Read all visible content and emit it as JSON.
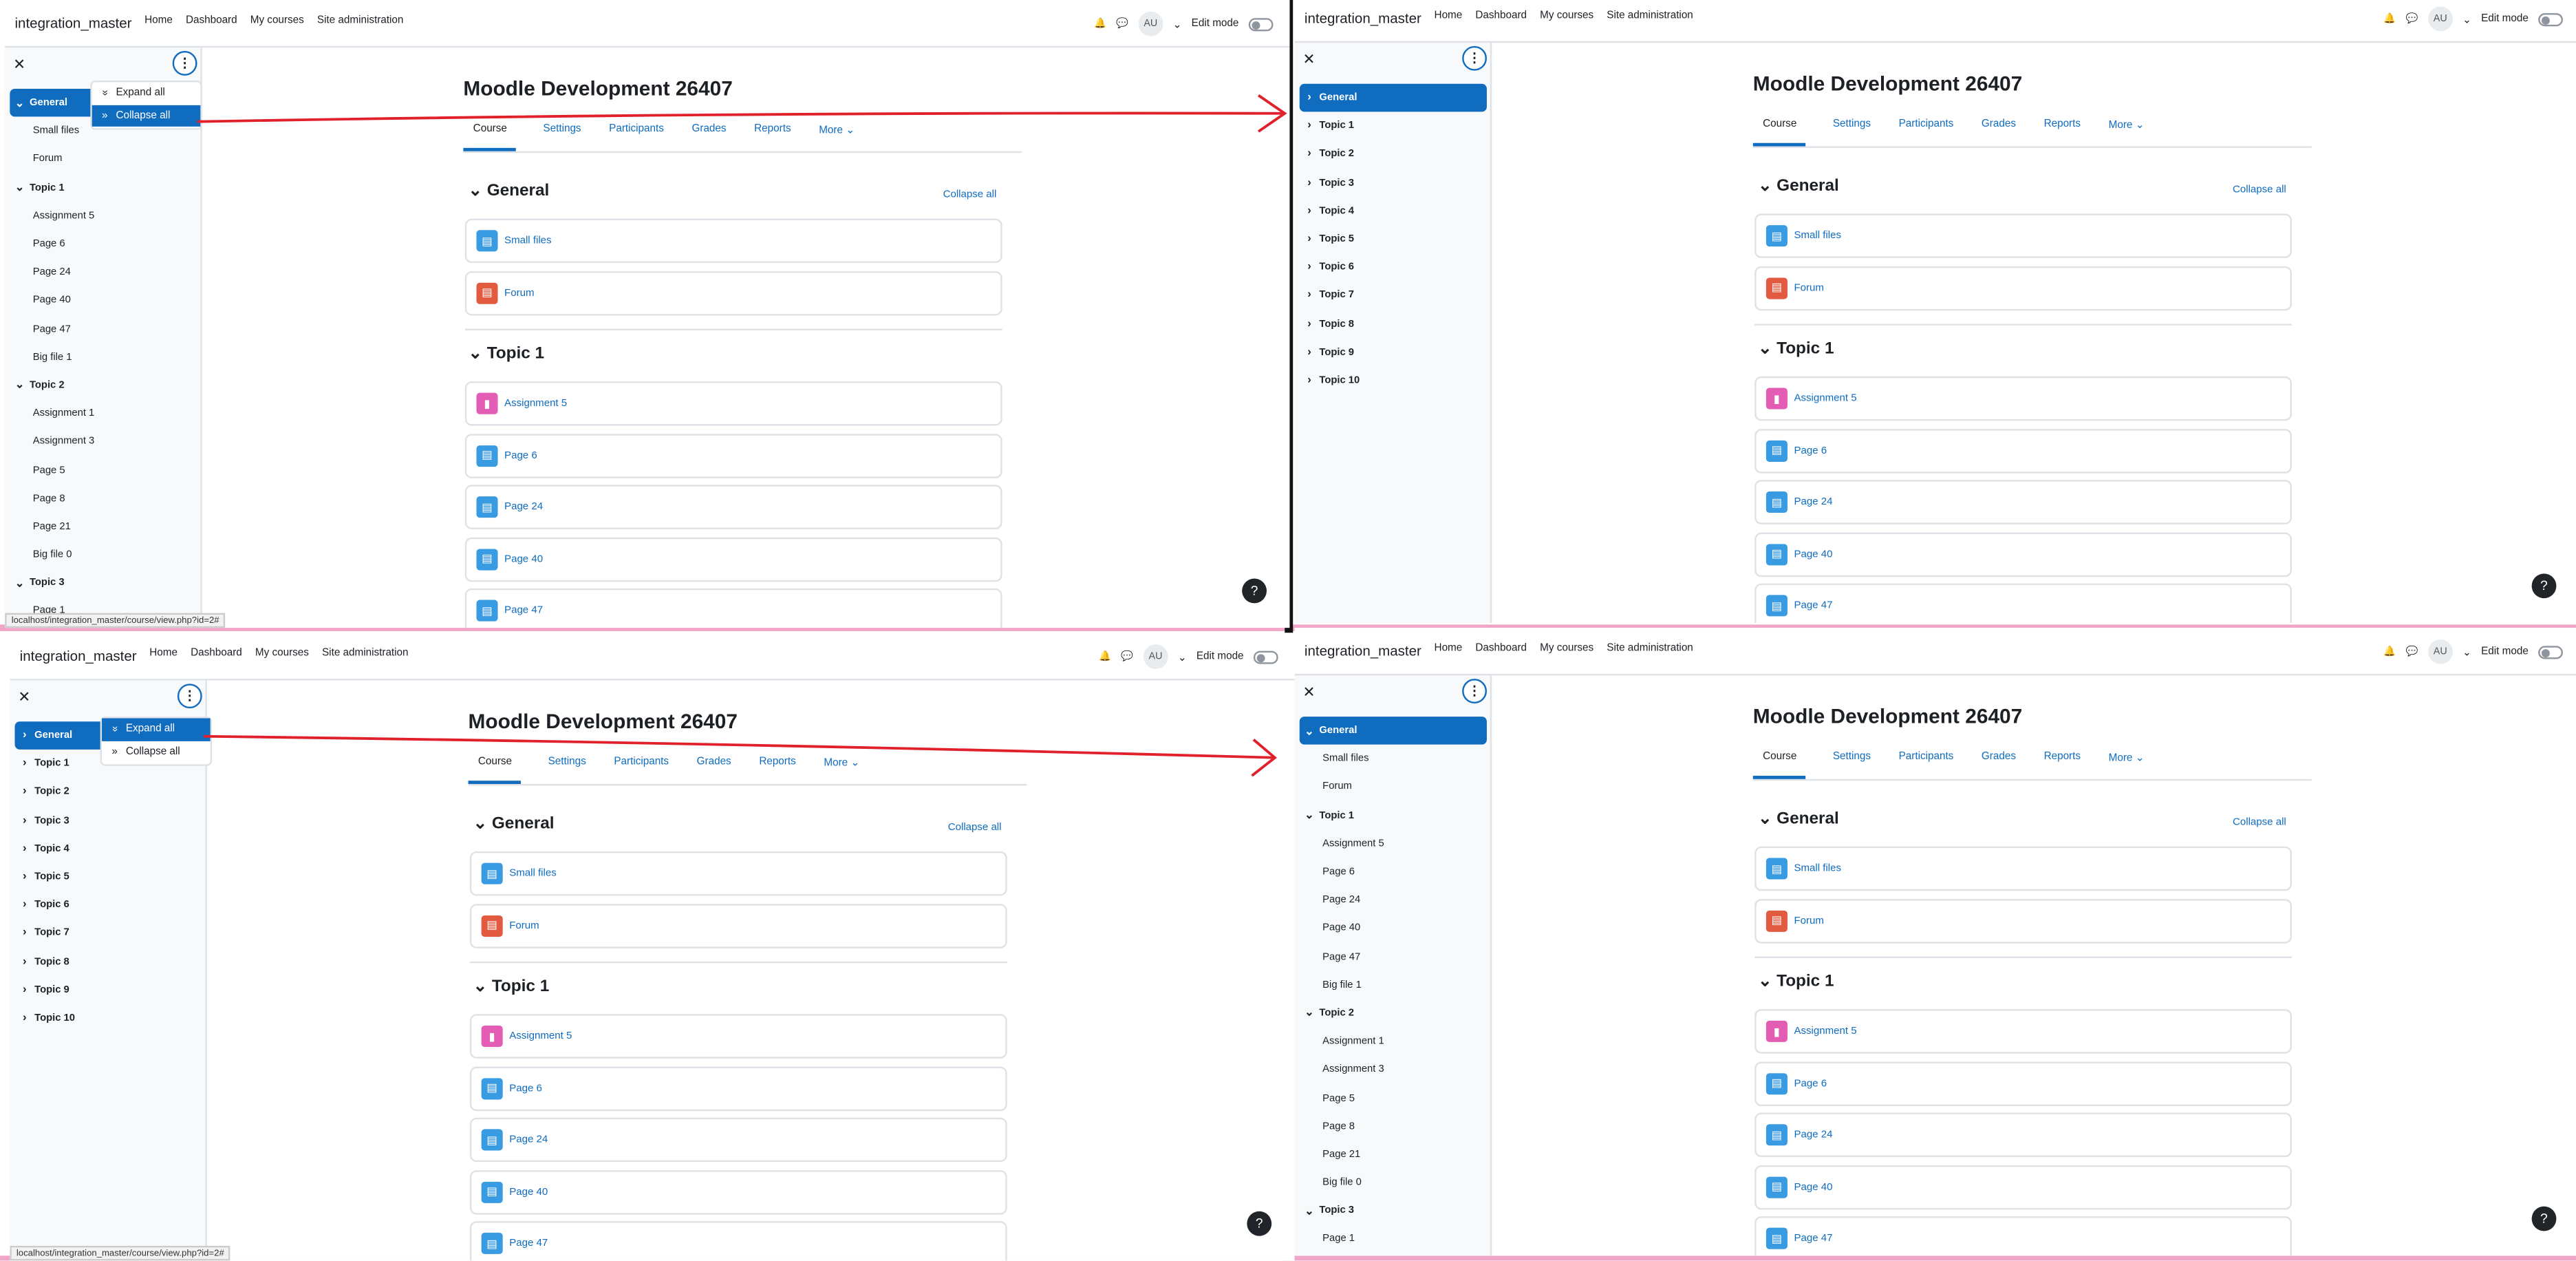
{
  "brand": "integration_master",
  "nav": [
    "Home",
    "Dashboard",
    "My courses",
    "Site administration"
  ],
  "user_initials": "AU",
  "edit_mode": "Edit mode",
  "course_title": "Moodle Development 26407",
  "tabs": [
    "Course",
    "Settings",
    "Participants",
    "Grades",
    "Reports",
    "More"
  ],
  "collapse_all": "Collapse all",
  "menu": {
    "expand": "Expand all",
    "collapse": "Collapse all"
  },
  "status_url": "localhost/integration_master/course/view.php?id=2#",
  "sections": {
    "general": "General",
    "topic1": "Topic 1"
  },
  "activities": {
    "general": [
      {
        "label": "Small files",
        "type": "file"
      },
      {
        "label": "Forum",
        "type": "forum"
      }
    ],
    "topic1": [
      {
        "label": "Assignment 5",
        "type": "assign"
      },
      {
        "label": "Page 6",
        "type": "file"
      },
      {
        "label": "Page 24",
        "type": "file"
      },
      {
        "label": "Page 40",
        "type": "file"
      },
      {
        "label": "Page 47",
        "type": "file"
      }
    ]
  },
  "drawer_expanded": [
    {
      "label": "General",
      "sec": true,
      "active": true
    },
    {
      "label": "Small files"
    },
    {
      "label": "Forum"
    },
    {
      "label": "Topic 1",
      "sec": true
    },
    {
      "label": "Assignment 5"
    },
    {
      "label": "Page 6"
    },
    {
      "label": "Page 24"
    },
    {
      "label": "Page 40"
    },
    {
      "label": "Page 47"
    },
    {
      "label": "Big file 1"
    },
    {
      "label": "Topic 2",
      "sec": true
    },
    {
      "label": "Assignment 1"
    },
    {
      "label": "Assignment 3"
    },
    {
      "label": "Page 5"
    },
    {
      "label": "Page 8"
    },
    {
      "label": "Page 21"
    },
    {
      "label": "Big file 0"
    },
    {
      "label": "Topic 3",
      "sec": true
    },
    {
      "label": "Page 1"
    }
  ],
  "drawer_collapsed": [
    "General",
    "Topic 1",
    "Topic 2",
    "Topic 3",
    "Topic 4",
    "Topic 5",
    "Topic 6",
    "Topic 7",
    "Topic 8",
    "Topic 9",
    "Topic 10"
  ],
  "colors": {
    "accent": "#0f6cbf",
    "arrow": "#e0202a",
    "divider": "#f2a6c7"
  }
}
